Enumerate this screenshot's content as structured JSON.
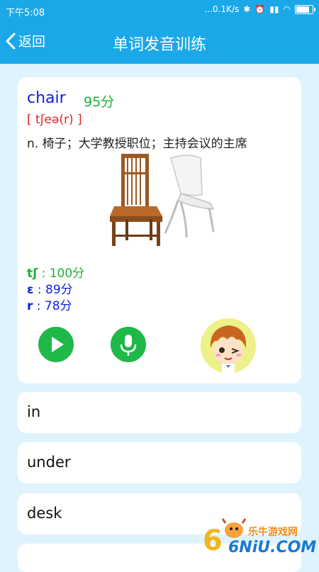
{
  "status": {
    "time": "下午5:08",
    "speed": "...0.1K/s"
  },
  "header": {
    "back_label": "返回",
    "title": "单词发音训练"
  },
  "word_card": {
    "word": "chair",
    "score": "95分",
    "phonetic": "[ tʃeə(r) ]",
    "definition": "n. 椅子；大学教授职位；主持会议的主席",
    "phonemes": [
      {
        "symbol": "tʃ",
        "score": ": 100分",
        "color": "#1fae3a"
      },
      {
        "symbol": "ɛ",
        "score": ": 89分",
        "color": "#0d1ee4"
      },
      {
        "symbol": "r",
        "score": ": 78分",
        "color": "#0d1ee4"
      }
    ],
    "icons": {
      "play": "play-icon",
      "mic": "microphone-icon"
    }
  },
  "word_list": [
    "in",
    "under",
    "desk",
    ""
  ],
  "watermark": {
    "brand": "乐牛游戏网",
    "domain": "6NiU.COM"
  },
  "colors": {
    "primary": "#1ba8e8",
    "background": "#dff3fc",
    "accent_green": "#1fb94a",
    "word_blue": "#0d1ee4",
    "phonetic_red": "#e61e1e"
  }
}
